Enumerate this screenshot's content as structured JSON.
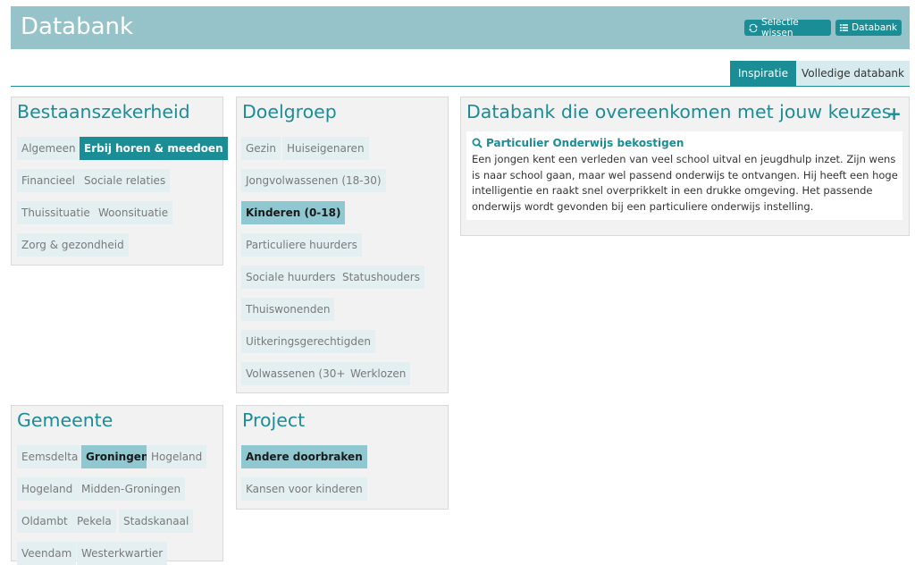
{
  "header": {
    "title": "Databank",
    "clear_button": "Selectie wissen",
    "databank_button": "Databank"
  },
  "tabs": [
    {
      "label": "Inspiratie",
      "active": true
    },
    {
      "label": "Volledige databank",
      "active": false
    }
  ],
  "panels": {
    "bestaanszekerheid": {
      "title": "Bestaanszekerheid",
      "tags": [
        "Algemeen",
        "Erbij horen & meedoen",
        "Financieel",
        "Sociale relaties",
        "Thuissituatie",
        "Woonsituatie",
        "Zorg & gezondheid"
      ],
      "selected": [
        "Erbij horen & meedoen"
      ]
    },
    "doelgroep": {
      "title": "Doelgroep",
      "tags": [
        "Gezin",
        "Huiseigenaren",
        "Jongvolwassenen (18-30)",
        "Kinderen (0-18)",
        "Particuliere huurders",
        "Sociale huurders",
        "Statushouders",
        "Thuiswonenden",
        "Uitkeringsgerechtigden",
        "Volwassenen (30+)",
        "Werklozen"
      ],
      "selected": [
        "Kinderen (0-18)"
      ]
    },
    "gemeente": {
      "title": "Gemeente",
      "tags": [
        "Eemsdelta",
        "Groningen",
        "Hogeland",
        "Hogeland",
        "Midden-Groningen",
        "Oldambt",
        "Pekela",
        "Stadskanaal",
        "Veendam",
        "Westerkwartier"
      ],
      "selected": [
        "Groningen"
      ]
    },
    "project": {
      "title": "Project",
      "tags": [
        "Andere doorbraken",
        "Kansen voor kinderen"
      ],
      "selected": [
        "Andere doorbraken"
      ]
    }
  },
  "results": {
    "title": "Databank die overeenkomen met jouw keuzes",
    "plus": "+",
    "items": [
      {
        "title": "Particulier Onderwijs bekostigen",
        "text": "Een jongen kent een verleden van veel school uitval en jeugdhulp inzet. Zijn wens is naar school gaan, maar wel passend onderwijs te ontvangen. Hij heeft een hoge intelligentie en raakt snel overprikkelt in een drukke omgeving. Het passende onderwijs wordt gevonden bij een particuliere onderwijs instelling."
      }
    ]
  },
  "colors": {
    "accent": "#1b8d97",
    "header_bg": "#96c3c9",
    "tag_bg": "#e4eff1",
    "selected_light": "#8fc8d0"
  }
}
